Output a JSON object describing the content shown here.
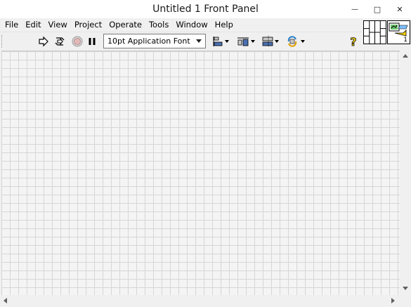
{
  "window": {
    "title": "Untitled 1 Front Panel",
    "minimize_glyph": "—",
    "maximize_glyph": "□",
    "close_glyph": "✕"
  },
  "menu": {
    "items": [
      "File",
      "Edit",
      "View",
      "Project",
      "Operate",
      "Tools",
      "Window",
      "Help"
    ]
  },
  "toolbar": {
    "font_select_value": "10pt Application Font",
    "help_glyph": "?",
    "icons": [
      "run-arrow-icon",
      "run-continuously-icon",
      "abort-execution-icon",
      "pause-icon",
      "align-objects-icon",
      "distribute-objects-icon",
      "resize-objects-icon",
      "reorder-icon",
      "context-help-icon"
    ]
  },
  "connector_icon": {
    "vi_number": "1"
  },
  "colors": {
    "grid_line": "#d6d6d6",
    "panel_bg": "#f4f4f4",
    "help_yellow": "#ffd800",
    "chrome_bg": "#f0f0f0"
  }
}
